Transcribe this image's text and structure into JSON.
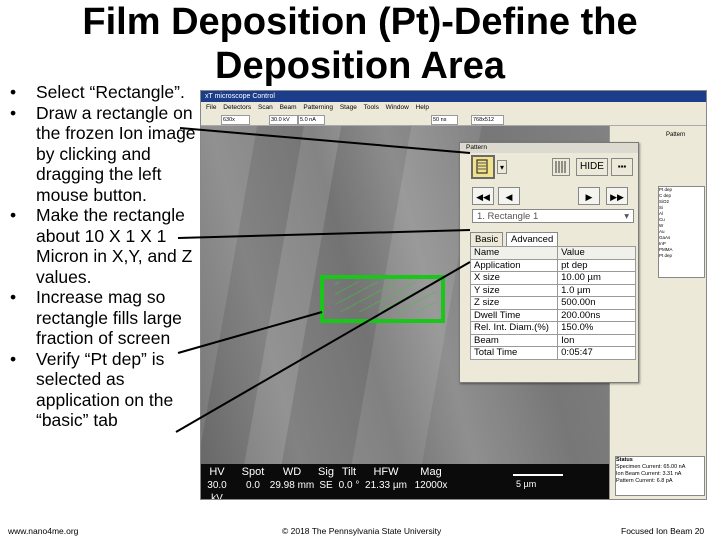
{
  "slide": {
    "title": "Film Deposition (Pt)-Define the Deposition Area",
    "bullets": [
      "Select “Rectangle”.",
      "Draw a rectangle on the frozen Ion image by clicking and dragging the left mouse button.",
      "Make the rectangle about 10 X 1 X 1 Micron in X,Y, and Z values.",
      "Increase mag so rectangle fills large fraction of screen",
      "Verify “Pt dep” is selected as application on the “basic” tab"
    ],
    "footer": {
      "left": "www.nano4me.org",
      "center": "© 2018 The Pennsylvania State University",
      "right": "Focused Ion Beam 20"
    }
  },
  "app": {
    "title": "xT microscope Control",
    "menu": [
      "File",
      "Detectors",
      "Scan",
      "Beam",
      "Patterning",
      "Stage",
      "Tools",
      "Window",
      "Help"
    ],
    "toolbar_fields": [
      "630x",
      "30.0 kV",
      "5.0 nA",
      "50 ns",
      "768x512"
    ],
    "infobar": {
      "labels": [
        "HV",
        "Spot",
        "WD",
        "Sig",
        "Tilt",
        "HFW",
        "Mag"
      ],
      "values": [
        "30.0 kV",
        "0.0",
        "29.98 mm",
        "SE",
        "0.0 °",
        "21.33 µm",
        "12000x"
      ],
      "scale": "5 µm"
    },
    "right_panel": {
      "header": "Pattern",
      "list": [
        "Pt dep",
        "C dep",
        "SiO2",
        "Si",
        "Al",
        "Cu",
        "W",
        "Au",
        "GaAs",
        "InP",
        "PMMA",
        "Pt dep"
      ],
      "status_title": "Status",
      "status_lines": [
        "Specimen Current: 65.00 nA",
        "Ion Beam Current: 3.31 nA",
        "Pattern Current: 6.8 pA"
      ]
    }
  },
  "pattern_panel": {
    "tab_label": "Pattern",
    "hide_button": "HIDE",
    "nav_buttons": [
      "◀◀",
      "◀",
      "▶",
      "▶▶"
    ],
    "selected_pattern": "1. Rectangle 1",
    "tabs": [
      "Basic",
      "Advanced"
    ],
    "table_header": [
      "Name",
      "Value"
    ],
    "rows": [
      {
        "name": "Application",
        "value": "pt dep"
      },
      {
        "name": "X size",
        "value": "10.00 µm"
      },
      {
        "name": "Y size",
        "value": "1.0 µm"
      },
      {
        "name": "Z size",
        "value": "500.00n"
      },
      {
        "name": "Dwell Time",
        "value": "200.00ns"
      },
      {
        "name": "Rel. Int. Diam.(%)",
        "value": "150.0%"
      },
      {
        "name": "Beam",
        "value": "Ion"
      },
      {
        "name": "Total Time",
        "value": "0:05:47"
      }
    ]
  },
  "colors": {
    "rect_outline": "#19c619",
    "infobar_bg": "#0b0b0b",
    "titlebar_bg": "#1b3d8a",
    "selected_tool_bg": "#f2e38a"
  }
}
